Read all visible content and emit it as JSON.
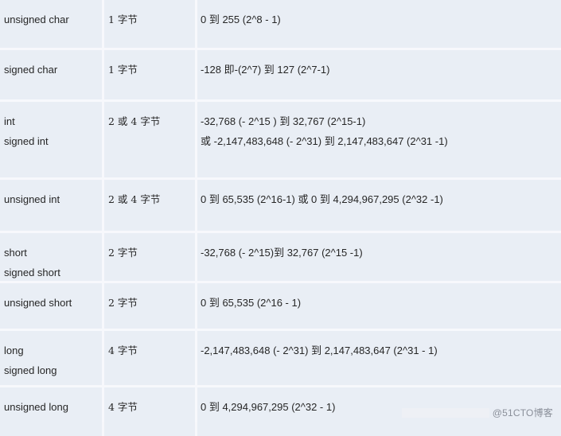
{
  "table": {
    "rows": [
      {
        "type": [
          "unsigned char"
        ],
        "size": "1 字节",
        "range": [
          "0  到  255 (2^8 - 1)"
        ]
      },
      {
        "type": [
          "signed char"
        ],
        "size": "1 字节",
        "range": [
          "-128  即-(2^7) 到  127 (2^7-1)"
        ]
      },
      {
        "type": [
          "int",
          "signed int"
        ],
        "size": "2 或 4 字节",
        "range": [
          "-32,768 (- 2^15 )  到  32,767 (2^15-1)",
          "或 -2,147,483,648 (- 2^31)  到  2,147,483,647 (2^31 -1)"
        ]
      },
      {
        "type": [
          "unsigned int"
        ],
        "size": "2 或 4 字节",
        "range": [
          "0  到  65,535 (2^16-1)  或  0  到  4,294,967,295 (2^32 -1)"
        ]
      },
      {
        "type": [
          "short",
          "signed short"
        ],
        "size": "2 字节",
        "range": [
          "-32,768 (- 2^15)到  32,767 (2^15 -1)"
        ]
      },
      {
        "type": [
          "unsigned short"
        ],
        "size": "2 字节",
        "range": [
          "0  到  65,535 (2^16 - 1)"
        ]
      },
      {
        "type": [
          "long",
          "signed long"
        ],
        "size": "4 字节",
        "range": [
          "-2,147,483,648 (- 2^31)  到  2,147,483,647 (2^31 - 1)"
        ]
      },
      {
        "type": [
          "unsigned long"
        ],
        "size": "4 字节",
        "range": [
          "0  到  4,294,967,295 (2^32 - 1)"
        ]
      }
    ]
  },
  "watermark": "@51CTO博客"
}
